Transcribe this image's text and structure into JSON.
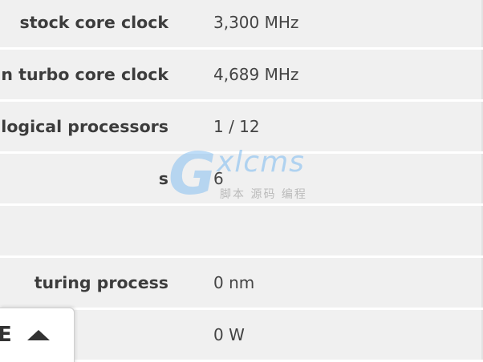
{
  "specs": {
    "rows": [
      {
        "label": "stock core clock",
        "value": "3,300 MHz"
      },
      {
        "label": "n turbo core clock",
        "value": "4,689 MHz"
      },
      {
        "label": "/ logical processors",
        "value": "1 / 12"
      },
      {
        "label": "s",
        "value": "6"
      },
      {
        "label": "",
        "value": ""
      },
      {
        "label": "turing process",
        "value": "0 nm"
      },
      {
        "label": "",
        "value": "0 W"
      }
    ]
  },
  "collapse_tab": {
    "label": "E",
    "icon": "caret-up-icon"
  },
  "watermark": {
    "logo": "G",
    "word": "xlcms",
    "subtitle": "脚本 源码 编程",
    "color": "#6eb4f0"
  }
}
